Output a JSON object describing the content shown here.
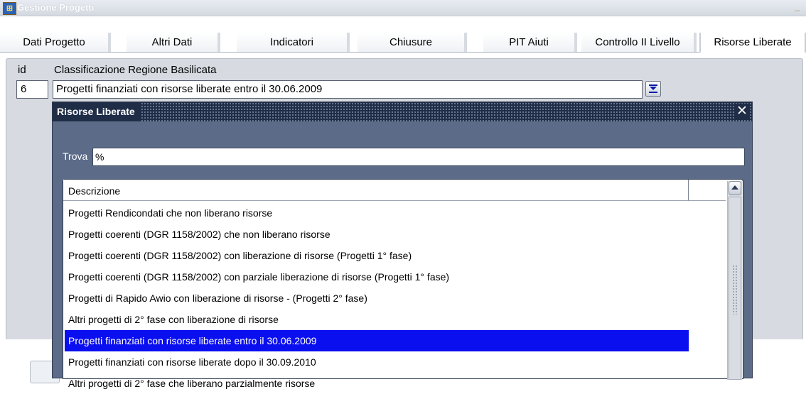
{
  "window": {
    "title": "Gestione Progetti"
  },
  "tabs": [
    {
      "label": "Dati Progetto"
    },
    {
      "label": "Altri Dati"
    },
    {
      "label": "Indicatori"
    },
    {
      "label": "Chiusure"
    },
    {
      "label": "PIT Aiuti"
    },
    {
      "label": "Controllo II Livello"
    },
    {
      "label": "Risorse Liberate"
    }
  ],
  "form": {
    "id_label": "id",
    "classification_label": "Classificazione Regione Basilicata",
    "id_value": "6",
    "classification_value": "Progetti finanziati con risorse liberate entro il 30.06.2009"
  },
  "lov": {
    "title": "Risorse Liberate",
    "find_label": "Trova",
    "find_value": "%",
    "column_header": "Descrizione",
    "items": [
      "Progetti Rendicondati che non liberano risorse",
      "Progetti coerenti (DGR 1158/2002) che non liberano risorse",
      "Progetti coerenti (DGR 1158/2002) con liberazione di risorse (Progetti 1° fase)",
      "Progetti coerenti (DGR 1158/2002) con parziale liberazione di risorse (Progetti 1° fase)",
      "Progetti di Rapido Awio con liberazione di risorse - (Progetti 2° fase)",
      "Altri progetti di 2° fase con liberazione di risorse",
      "Progetti finanziati con risorse liberate entro il 30.06.2009",
      "Progetti finanziati con risorse liberate dopo il 30.09.2010",
      "Altri progetti di 2° fase che liberano parzialmente risorse"
    ],
    "selected_index": 6
  },
  "colors": {
    "selection": "#0a0ff0",
    "dialog_title_bg": "#1f2d47",
    "dialog_body_bg": "#5b6b88",
    "canvas_bg": "#d7dbe1"
  },
  "icons": {
    "app": "forms-app-icon",
    "lov": "list-of-values-icon",
    "close": "close-icon"
  }
}
